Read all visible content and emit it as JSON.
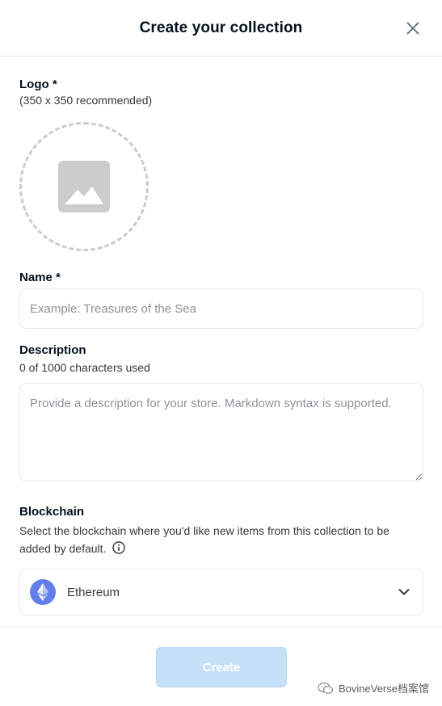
{
  "modal": {
    "title": "Create your collection"
  },
  "logo": {
    "label": "Logo *",
    "hint": "(350 x 350 recommended)"
  },
  "name": {
    "label": "Name *",
    "value": "",
    "placeholder": "Example: Treasures of the Sea"
  },
  "description": {
    "label": "Description",
    "counter": "0 of 1000 characters used",
    "value": "",
    "placeholder": "Provide a description for your store. Markdown syntax is supported."
  },
  "blockchain": {
    "label": "Blockchain",
    "helper": "Select the blockchain where you'd like new items from this collection to be added by default.",
    "selected": "Ethereum"
  },
  "footer": {
    "create_label": "Create",
    "watermark": "BovineVerse档案馆"
  },
  "icons": {
    "close": "close-icon",
    "image": "image-placeholder-icon",
    "info": "info-icon",
    "ethereum": "ethereum-icon",
    "chevron": "chevron-down-icon"
  },
  "colors": {
    "accent": "#2081e2",
    "create_disabled_bg": "#c5e0f7",
    "ethereum": "#627eea",
    "border": "#e5e8eb",
    "placeholder_text": "#8a939b"
  }
}
